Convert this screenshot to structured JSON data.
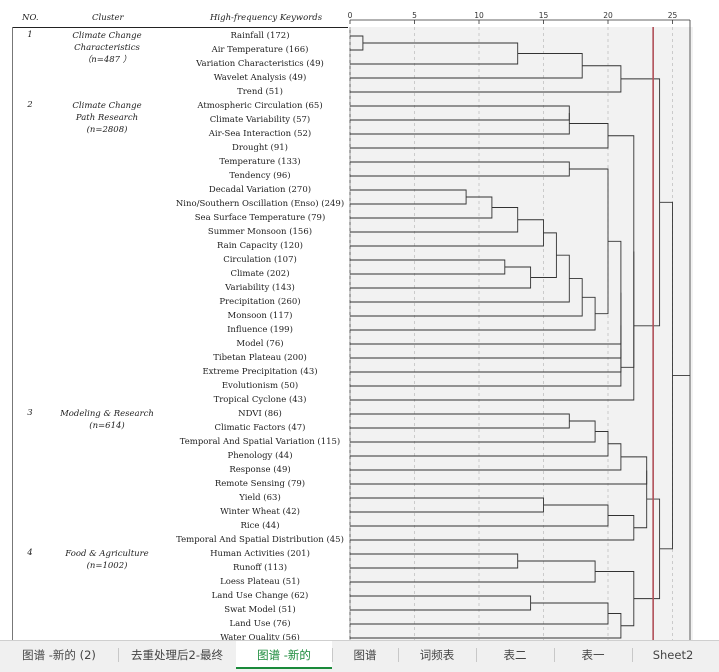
{
  "table": {
    "headers": {
      "no": "NO.",
      "cluster": "Cluster",
      "keywords": "High-frequency Keywords"
    },
    "clusters": [
      {
        "no": "1",
        "lines": [
          "Climate Change",
          "Characteristics",
          "（n=487 ）"
        ],
        "row": 0
      },
      {
        "no": "2",
        "lines": [
          "Climate Change",
          "Path Research",
          "(n=2808)"
        ],
        "row": 5
      },
      {
        "no": "3",
        "lines": [
          "Modeling & Research",
          "(n=614)"
        ],
        "row": 27
      },
      {
        "no": "4",
        "lines": [
          "Food & Agriculture",
          "(n=1002)"
        ],
        "row": 37
      }
    ],
    "keywords": [
      "Rainfall (172)",
      "Air Temperature (166)",
      "Variation Characteristics (49)",
      "Wavelet Analysis (49)",
      "Trend (51)",
      "Atmospheric Circulation (65)",
      "Climate Variability (57)",
      "Air-Sea Interaction (52)",
      "Drought (91)",
      "Temperature (133)",
      "Tendency (96)",
      "Decadal Variation (270)",
      "Nino/Southern Oscillation (Enso) (249)",
      "Sea Surface Temperature (79)",
      "Summer Monsoon (156)",
      "Rain Capacity (120)",
      "Circulation (107)",
      "Climate (202)",
      "Variability (143)",
      "Precipitation (260)",
      "Monsoon (117)",
      "Influence (199)",
      "Model (76)",
      "Tibetan Plateau (200)",
      "Extreme Precipitation (43)",
      "Evolutionism (50)",
      "Tropical Cyclone (43)",
      "NDVI (86)",
      "Climatic Factors (47)",
      "Temporal And Spatial Variation (115)",
      "Phenology (44)",
      "Response (49)",
      "Remote Sensing (79)",
      "Yield (63)",
      "Winter Wheat (42)",
      "Rice (44)",
      "Temporal And Spatial Distribution (45)",
      "Human Activities (201)",
      "Runoff (113)",
      "Loess Plateau (51)",
      "Land Use Change (62)",
      "Swat Model (51)",
      "Land Use (76)",
      "Water Quality (56)"
    ]
  },
  "chart_data": {
    "type": "dendrogram",
    "axis_ticks": [
      "0",
      "5",
      "10",
      "15",
      "20",
      "25"
    ],
    "xlim": [
      0,
      25
    ],
    "cut_line": 23.5,
    "cut_line_color": "#b05058",
    "merges": [
      {
        "a": 0,
        "b": 1,
        "h": 1
      },
      {
        "a": "m0",
        "b": 2,
        "h": 13
      },
      {
        "a": "m1",
        "b": 3,
        "h": 18
      },
      {
        "a": "m2",
        "b": 4,
        "h": 21
      },
      {
        "a": 5,
        "b": 6,
        "h": 17
      },
      {
        "a": "m4",
        "b": 7,
        "h": 17
      },
      {
        "a": "m5",
        "b": 8,
        "h": 20
      },
      {
        "a": 12,
        "b": 11,
        "h": 9
      },
      {
        "a": "m7",
        "b": 13,
        "h": 11
      },
      {
        "a": "m8",
        "b": 14,
        "h": 13
      },
      {
        "a": "m9",
        "b": 15,
        "h": 15
      },
      {
        "a": 16,
        "b": 17,
        "h": 12
      },
      {
        "a": "m11",
        "b": 18,
        "h": 14
      },
      {
        "a": "m10",
        "b": "m12",
        "h": 16
      },
      {
        "a": "m13",
        "b": 19,
        "h": 17
      },
      {
        "a": "m14",
        "b": 20,
        "h": 18
      },
      {
        "a": "m15",
        "b": 21,
        "h": 19
      },
      {
        "a": 9,
        "b": 10,
        "h": 17
      },
      {
        "a": "m17",
        "b": "m16",
        "h": 20
      },
      {
        "a": "m18",
        "b": 22,
        "h": 21
      },
      {
        "a": "m19",
        "b": 23,
        "h": 21
      },
      {
        "a": "m20",
        "b": 24,
        "h": 21
      },
      {
        "a": "m21",
        "b": 25,
        "h": 21
      },
      {
        "a": "m6",
        "b": "m22",
        "h": 22
      },
      {
        "a": "m23",
        "b": 26,
        "h": 22
      },
      {
        "a": "m3",
        "b": "m24",
        "h": 24
      },
      {
        "a": 27,
        "b": 28,
        "h": 17
      },
      {
        "a": "m26",
        "b": 29,
        "h": 19
      },
      {
        "a": "m27",
        "b": 30,
        "h": 20
      },
      {
        "a": "m28",
        "b": 31,
        "h": 21
      },
      {
        "a": 33,
        "b": 34,
        "h": 15
      },
      {
        "a": "m30",
        "b": 35,
        "h": 20
      },
      {
        "a": "m31",
        "b": 36,
        "h": 22
      },
      {
        "a": "m29",
        "b": 32,
        "h": 23
      },
      {
        "a": "m33",
        "b": "m32",
        "h": 23
      },
      {
        "a": 37,
        "b": 38,
        "h": 13
      },
      {
        "a": "m35",
        "b": 39,
        "h": 19
      },
      {
        "a": 40,
        "b": 41,
        "h": 14
      },
      {
        "a": "m37",
        "b": 42,
        "h": 20
      },
      {
        "a": "m38",
        "b": 43,
        "h": 21
      },
      {
        "a": "m36",
        "b": "m39",
        "h": 22
      },
      {
        "a": "m34",
        "b": "m40",
        "h": 24
      },
      {
        "a": "m41",
        "b": "m25",
        "h": 25
      }
    ]
  },
  "tabs": [
    {
      "label": "图谱 -新的 (2)",
      "active": false
    },
    {
      "label": "去重处理后2-最终",
      "active": false
    },
    {
      "label": "图谱 -新的",
      "active": true
    },
    {
      "label": "图谱",
      "active": false
    },
    {
      "label": "词频表",
      "active": false
    },
    {
      "label": "表二",
      "active": false
    },
    {
      "label": "表一",
      "active": false
    },
    {
      "label": "Sheet2",
      "active": false
    }
  ]
}
